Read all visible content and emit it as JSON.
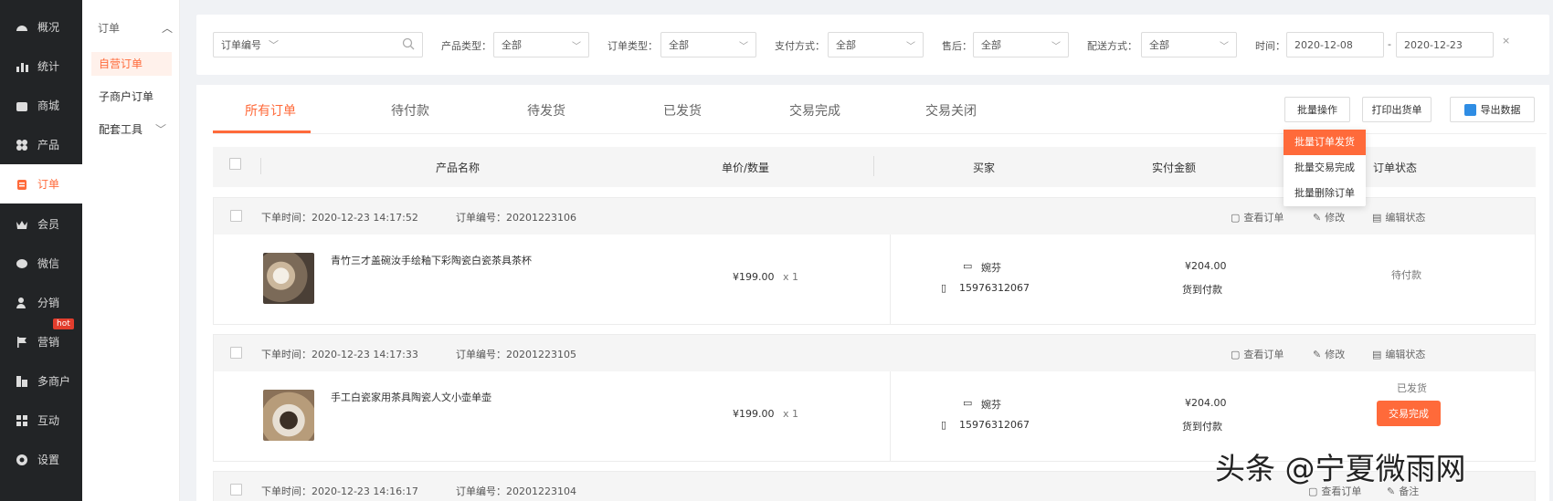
{
  "nav": {
    "items": [
      {
        "label": "概况",
        "icon": "dashboard-icon"
      },
      {
        "label": "统计",
        "icon": "chart-icon"
      },
      {
        "label": "商城",
        "icon": "shop-icon"
      },
      {
        "label": "产品",
        "icon": "grid-icon"
      },
      {
        "label": "订单",
        "icon": "order-icon",
        "active": true
      },
      {
        "label": "会员",
        "icon": "crown-icon"
      },
      {
        "label": "微信",
        "icon": "wechat-icon"
      },
      {
        "label": "分销",
        "icon": "user-share-icon"
      },
      {
        "label": "营销",
        "icon": "flag-icon",
        "badge": "hot"
      },
      {
        "label": "多商户",
        "icon": "merchant-icon"
      },
      {
        "label": "互动",
        "icon": "interact-icon"
      },
      {
        "label": "设置",
        "icon": "gear-icon"
      }
    ]
  },
  "subnav": {
    "title": "订单",
    "items": [
      "自营订单",
      "子商户订单",
      "配套工具"
    ]
  },
  "filter": {
    "search_type": "订单编号",
    "product_type_label": "产品类型：",
    "product_type_value": "全部",
    "order_type_label": "订单类型：",
    "order_type_value": "全部",
    "pay_method_label": "支付方式：",
    "pay_method_value": "全部",
    "aftersale_label": "售后：",
    "aftersale_value": "全部",
    "delivery_label": "配送方式：",
    "delivery_value": "全部",
    "time_label": "时间：",
    "date_from": "2020-12-08",
    "date_sep": "-",
    "date_to": "2020-12-23",
    "clear": "×"
  },
  "tabs": [
    "所有订单",
    "待付款",
    "待发货",
    "已发货",
    "交易完成",
    "交易关闭"
  ],
  "toolbar": {
    "batch": "批量操作",
    "print": "打印出货单",
    "export": "导出数据"
  },
  "batch_menu": [
    "批量订单发货",
    "批量交易完成",
    "批量删除订单"
  ],
  "table_head": {
    "product": "产品名称",
    "price_qty": "单价/数量",
    "buyer": "买家",
    "paid": "实付金额",
    "status": "订单状态"
  },
  "orders": [
    {
      "time_label": "下单时间：",
      "time": "2020-12-23 14:17:52",
      "no_label": "订单编号：",
      "no": "20201223106",
      "actions": [
        "查看订单",
        "修改",
        "编辑状态"
      ],
      "product": "青竹三才盖碗汝手绘釉下彩陶瓷白瓷茶具茶杯",
      "price": "¥199.00",
      "qty": "x 1",
      "buyer_name": "婉芬",
      "buyer_phone": "15976312067",
      "paid": "¥204.00",
      "pay_method": "货到付款",
      "status": "待付款"
    },
    {
      "time_label": "下单时间：",
      "time": "2020-12-23 14:17:33",
      "no_label": "订单编号：",
      "no": "20201223105",
      "actions": [
        "查看订单",
        "修改",
        "编辑状态"
      ],
      "product": "手工白瓷家用茶具陶瓷人文小壶单壶",
      "price": "¥199.00",
      "qty": "x 1",
      "buyer_name": "婉芬",
      "buyer_phone": "15976312067",
      "paid": "¥204.00",
      "pay_method": "货到付款",
      "status": "已发货",
      "status_button": "交易完成"
    },
    {
      "time_label": "下单时间：",
      "time": "2020-12-23 14:16:17",
      "no_label": "订单编号：",
      "no": "20201223104",
      "actions": [
        "查看订单",
        "备注"
      ]
    }
  ],
  "watermark": "头条 @宁夏微雨网",
  "colors": {
    "accent": "#ff6a3a",
    "nav_bg": "#222426"
  }
}
